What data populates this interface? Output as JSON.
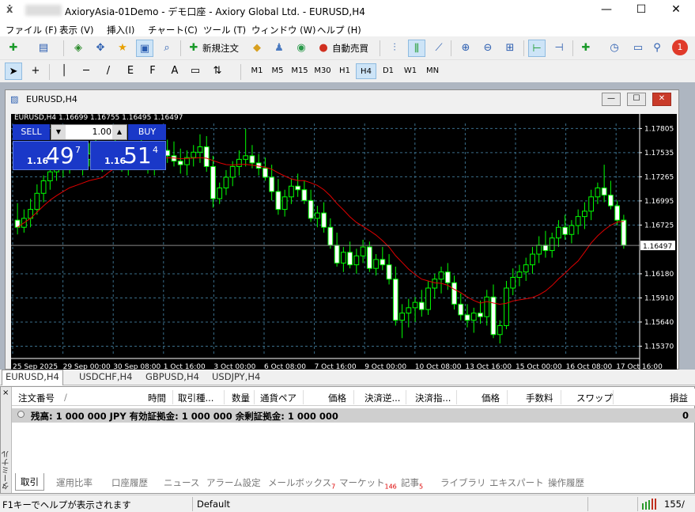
{
  "window": {
    "title": "AxioryAsia-01Demo - デモ口座 - Axiory Global Ltd. - EURUSD,H4",
    "controls": [
      "—",
      "☐",
      "✕"
    ]
  },
  "menu": [
    "ファイル (F)",
    "表示 (V)",
    "挿入(I)",
    "チャート(C)",
    "ツール (T)",
    "ウィンドウ (W)",
    "ヘルプ (H)"
  ],
  "toolbar": {
    "new_order_label": "新規注文",
    "auto_trade_label": "自動売買",
    "notification_count": "1"
  },
  "tools": [
    "+",
    "/",
    "F",
    "E",
    "A"
  ],
  "timeframes": [
    "M1",
    "M5",
    "M15",
    "M30",
    "H1",
    "H4",
    "D1",
    "W1",
    "MN"
  ],
  "active_timeframe": "H4",
  "chart_window": {
    "title": "EURUSD,H4",
    "controls": [
      "—",
      "☐",
      "✕"
    ],
    "info_line": "EURUSD,H4  1.16699 1.16755 1.16495 1.16497"
  },
  "one_click": {
    "sell_label": "SELL",
    "buy_label": "BUY",
    "lot": "1.00",
    "sell_prefix": "1.16",
    "sell_big": "49",
    "sell_small": "7",
    "buy_prefix": "1.16",
    "buy_big": "51",
    "buy_small": "4"
  },
  "chart_data": {
    "type": "candlestick",
    "symbol": "EURUSD",
    "timeframe": "H4",
    "y_ticks": [
      "1.17805",
      "1.17535",
      "1.17265",
      "1.16995",
      "1.16725",
      "1.16497",
      "1.16180",
      "1.15910",
      "1.15640",
      "1.15370"
    ],
    "current_price": "1.16497",
    "x_ticks": [
      "25 Sep 2025",
      "29 Sep 00:00",
      "30 Sep 08:00",
      "1 Oct 16:00",
      "3 Oct 00:00",
      "6 Oct 08:00",
      "7 Oct 16:00",
      "9 Oct 00:00",
      "10 Oct 08:00",
      "13 Oct 16:00",
      "15 Oct 00:00",
      "16 Oct 08:00",
      "17 Oct 16:00"
    ],
    "ylim": [
      1.1525,
      1.1795
    ],
    "colors": {
      "bull": "#000000",
      "bear": "#ffffff",
      "outline": "#00ff00",
      "ma": "#e00000",
      "grid": "#3a6e8a",
      "background": "#000000"
    },
    "candles": [
      [
        1.1678,
        1.1697,
        1.1662,
        1.167
      ],
      [
        1.167,
        1.169,
        1.1664,
        1.168
      ],
      [
        1.168,
        1.1702,
        1.167,
        1.169
      ],
      [
        1.169,
        1.1718,
        1.1684,
        1.1708
      ],
      [
        1.1708,
        1.1728,
        1.1698,
        1.1722
      ],
      [
        1.1722,
        1.1745,
        1.1712,
        1.1732
      ],
      [
        1.1732,
        1.1752,
        1.1722,
        1.1736
      ],
      [
        1.1736,
        1.1752,
        1.1726,
        1.1742
      ],
      [
        1.1742,
        1.176,
        1.173,
        1.1748
      ],
      [
        1.1748,
        1.176,
        1.1736,
        1.174
      ],
      [
        1.174,
        1.1756,
        1.1728,
        1.1746
      ],
      [
        1.1746,
        1.1764,
        1.1738,
        1.1752
      ],
      [
        1.1752,
        1.1768,
        1.174,
        1.1744
      ],
      [
        1.1744,
        1.176,
        1.1732,
        1.1748
      ],
      [
        1.1748,
        1.1764,
        1.1738,
        1.1754
      ],
      [
        1.1754,
        1.177,
        1.174,
        1.1746
      ],
      [
        1.1746,
        1.1762,
        1.1732,
        1.174
      ],
      [
        1.174,
        1.1756,
        1.1728,
        1.1748
      ],
      [
        1.1748,
        1.1762,
        1.1738,
        1.1754
      ],
      [
        1.1754,
        1.1768,
        1.174,
        1.1744
      ],
      [
        1.1744,
        1.1758,
        1.173,
        1.1738
      ],
      [
        1.1738,
        1.1756,
        1.1728,
        1.1748
      ],
      [
        1.1748,
        1.1762,
        1.1736,
        1.1756
      ],
      [
        1.1756,
        1.1768,
        1.1742,
        1.175
      ],
      [
        1.175,
        1.1766,
        1.1738,
        1.1744
      ],
      [
        1.1744,
        1.1758,
        1.173,
        1.174
      ],
      [
        1.174,
        1.1756,
        1.1728,
        1.1748
      ],
      [
        1.1748,
        1.1762,
        1.1738,
        1.1754
      ],
      [
        1.1754,
        1.1774,
        1.1742,
        1.176
      ],
      [
        1.176,
        1.1772,
        1.1732,
        1.1738
      ],
      [
        1.1738,
        1.175,
        1.1692,
        1.1702
      ],
      [
        1.1702,
        1.172,
        1.1696,
        1.1714
      ],
      [
        1.1714,
        1.1734,
        1.1706,
        1.1726
      ],
      [
        1.1726,
        1.1744,
        1.1716,
        1.1738
      ],
      [
        1.1738,
        1.1756,
        1.1728,
        1.1746
      ],
      [
        1.1746,
        1.178,
        1.1738,
        1.175
      ],
      [
        1.175,
        1.1762,
        1.1736,
        1.1742
      ],
      [
        1.1742,
        1.1752,
        1.1728,
        1.1736
      ],
      [
        1.1736,
        1.1748,
        1.1722,
        1.1726
      ],
      [
        1.1726,
        1.174,
        1.17,
        1.171
      ],
      [
        1.171,
        1.1724,
        1.1684,
        1.169
      ],
      [
        1.169,
        1.1712,
        1.1682,
        1.1704
      ],
      [
        1.1704,
        1.1724,
        1.1696,
        1.1716
      ],
      [
        1.1716,
        1.173,
        1.1704,
        1.1712
      ],
      [
        1.1712,
        1.1722,
        1.1696,
        1.17
      ],
      [
        1.17,
        1.1712,
        1.1676,
        1.168
      ],
      [
        1.168,
        1.1694,
        1.167,
        1.1686
      ],
      [
        1.1686,
        1.1698,
        1.1664,
        1.167
      ],
      [
        1.167,
        1.168,
        1.1646,
        1.165
      ],
      [
        1.165,
        1.1664,
        1.1626,
        1.163
      ],
      [
        1.163,
        1.1648,
        1.162,
        1.1642
      ],
      [
        1.1642,
        1.1654,
        1.1624,
        1.1628
      ],
      [
        1.1628,
        1.1646,
        1.1618,
        1.1638
      ],
      [
        1.1638,
        1.1656,
        1.163,
        1.1648
      ],
      [
        1.1648,
        1.1654,
        1.162,
        1.1624
      ],
      [
        1.1624,
        1.164,
        1.1616,
        1.1634
      ],
      [
        1.1634,
        1.1648,
        1.1622,
        1.1628
      ],
      [
        1.1628,
        1.164,
        1.1606,
        1.1612
      ],
      [
        1.1612,
        1.1626,
        1.156,
        1.1566
      ],
      [
        1.1566,
        1.1584,
        1.1546,
        1.1574
      ],
      [
        1.1574,
        1.159,
        1.1558,
        1.158
      ],
      [
        1.158,
        1.1592,
        1.1564,
        1.1586
      ],
      [
        1.1586,
        1.16,
        1.157,
        1.1578
      ],
      [
        1.1578,
        1.161,
        1.1572,
        1.1602
      ],
      [
        1.1602,
        1.1618,
        1.159,
        1.1612
      ],
      [
        1.1612,
        1.1626,
        1.1596,
        1.162
      ],
      [
        1.162,
        1.163,
        1.16,
        1.1608
      ],
      [
        1.1608,
        1.1616,
        1.1578,
        1.1584
      ],
      [
        1.1584,
        1.1596,
        1.1566,
        1.1572
      ],
      [
        1.1572,
        1.1584,
        1.1558,
        1.1566
      ],
      [
        1.1566,
        1.158,
        1.1552,
        1.1574
      ],
      [
        1.1574,
        1.1588,
        1.1562,
        1.157
      ],
      [
        1.157,
        1.16,
        1.156,
        1.1592
      ],
      [
        1.1592,
        1.1606,
        1.1546,
        1.155
      ],
      [
        1.155,
        1.1566,
        1.154,
        1.156
      ],
      [
        1.156,
        1.161,
        1.1556,
        1.1602
      ],
      [
        1.1602,
        1.1624,
        1.1594,
        1.1614
      ],
      [
        1.1614,
        1.1628,
        1.1604,
        1.162
      ],
      [
        1.162,
        1.1636,
        1.161,
        1.1628
      ],
      [
        1.1628,
        1.1648,
        1.1618,
        1.164
      ],
      [
        1.164,
        1.166,
        1.163,
        1.165
      ],
      [
        1.165,
        1.1666,
        1.1636,
        1.1644
      ],
      [
        1.1644,
        1.1664,
        1.1636,
        1.1658
      ],
      [
        1.1658,
        1.1678,
        1.1648,
        1.167
      ],
      [
        1.167,
        1.1684,
        1.1656,
        1.1662
      ],
      [
        1.1662,
        1.1678,
        1.1652,
        1.1672
      ],
      [
        1.1672,
        1.169,
        1.1662,
        1.1682
      ],
      [
        1.1682,
        1.1698,
        1.1668,
        1.1688
      ],
      [
        1.1688,
        1.1712,
        1.1678,
        1.1704
      ],
      [
        1.1704,
        1.172,
        1.1696,
        1.1714
      ],
      [
        1.1714,
        1.174,
        1.1698,
        1.1706
      ],
      [
        1.1706,
        1.1722,
        1.169,
        1.1694
      ],
      [
        1.1694,
        1.17,
        1.1672,
        1.1678
      ],
      [
        1.1678,
        1.1684,
        1.1646,
        1.165
      ]
    ]
  },
  "chart_tabs": [
    "EURUSD,H4",
    "USDCHF,H4",
    "GBPUSD,H4",
    "USDJPY,H4"
  ],
  "terminal": {
    "side_label": "ターミナル",
    "close": "×",
    "columns": [
      "注文番号",
      "/",
      "時間",
      "取引種...",
      "数量",
      "通貨ペア",
      "価格",
      "決済逆...",
      "決済指...",
      "価格",
      "手数料",
      "スワップ",
      "損益"
    ],
    "balance_text": "残高: 1 000 000 JPY  有効証拠金: 1 000 000  余剰証拠金: 1 000 000",
    "balance_value": "0",
    "tabs": [
      {
        "label": "取引",
        "badge": ""
      },
      {
        "label": "運用比率",
        "badge": ""
      },
      {
        "label": "口座履歴",
        "badge": ""
      },
      {
        "label": "ニュース",
        "badge": ""
      },
      {
        "label": "アラーム設定",
        "badge": ""
      },
      {
        "label": "メールボックス",
        "badge": "7"
      },
      {
        "label": "マーケット",
        "badge": "146"
      },
      {
        "label": "記事",
        "badge": "5"
      },
      {
        "label": "ライブラリ",
        "badge": ""
      },
      {
        "label": "エキスパート",
        "badge": ""
      },
      {
        "label": "操作履歴",
        "badge": ""
      }
    ]
  },
  "status": {
    "help": "F1キーでヘルプが表示されます",
    "profile": "Default",
    "traffic": "155/"
  }
}
